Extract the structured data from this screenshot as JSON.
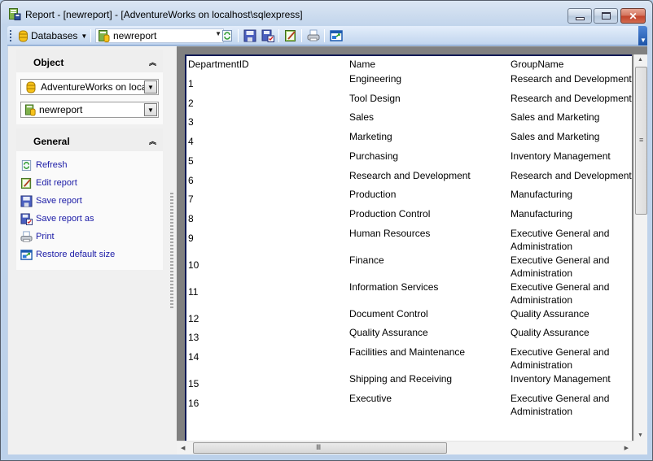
{
  "window": {
    "title": "Report - [newreport] - [AdventureWorks on localhost\\sqlexpress]",
    "controls": {
      "minimize": "minimize",
      "maximize": "maximize",
      "close": "close"
    }
  },
  "toolbar": {
    "databases_label": "Databases",
    "report_combo_value": "newreport",
    "buttons": [
      "Refresh",
      "Save report",
      "Save report as",
      "Edit report",
      "Print",
      "Restore default size"
    ]
  },
  "sidebar": {
    "object_panel": {
      "title": "Object",
      "database_value": "AdventureWorks on localhost\\sqlexpress",
      "report_value": "newreport"
    },
    "general_panel": {
      "title": "General",
      "actions": [
        {
          "label": "Refresh",
          "icon": "refresh-icon"
        },
        {
          "label": "Edit report",
          "icon": "edit-report-icon"
        },
        {
          "label": "Save report",
          "icon": "save-icon"
        },
        {
          "label": "Save report as",
          "icon": "save-as-icon"
        },
        {
          "label": "Print",
          "icon": "print-icon"
        },
        {
          "label": "Restore default size",
          "icon": "restore-size-icon"
        }
      ]
    }
  },
  "report": {
    "columns": [
      "DepartmentID",
      "Name",
      "GroupName"
    ],
    "rows": [
      {
        "id": "1",
        "name": "Engineering",
        "group": [
          "Research and Development"
        ]
      },
      {
        "id": "2",
        "name": "Tool Design",
        "group": [
          "Research and Development"
        ]
      },
      {
        "id": "3",
        "name": "Sales",
        "group": [
          "Sales and Marketing"
        ]
      },
      {
        "id": "4",
        "name": "Marketing",
        "group": [
          "Sales and Marketing"
        ]
      },
      {
        "id": "5",
        "name": "Purchasing",
        "group": [
          "Inventory Management"
        ]
      },
      {
        "id": "6",
        "name": "Research and Development",
        "group": [
          "Research and Development"
        ]
      },
      {
        "id": "7",
        "name": "Production",
        "group": [
          "Manufacturing"
        ]
      },
      {
        "id": "8",
        "name": "Production Control",
        "group": [
          "Manufacturing"
        ]
      },
      {
        "id": "9",
        "name": "Human Resources",
        "group": [
          "Executive General and",
          "Administration"
        ]
      },
      {
        "id": "10",
        "name": "Finance",
        "group": [
          "Executive General and",
          "Administration"
        ]
      },
      {
        "id": "11",
        "name": "Information Services",
        "group": [
          "Executive General and",
          "Administration"
        ]
      },
      {
        "id": "12",
        "name": "Document Control",
        "group": [
          "Quality Assurance"
        ]
      },
      {
        "id": "13",
        "name": "Quality Assurance",
        "group": [
          "Quality Assurance"
        ]
      },
      {
        "id": "14",
        "name": "Facilities and Maintenance",
        "group": [
          "Executive General and",
          "Administration"
        ]
      },
      {
        "id": "15",
        "name": "Shipping and Receiving",
        "group": [
          "Inventory Management"
        ]
      },
      {
        "id": "16",
        "name": "Executive",
        "group": [
          "Executive General and",
          "Administration"
        ]
      }
    ]
  },
  "scrollbars": {
    "vertical_position": 0.0,
    "horizontal_position": 0.0
  }
}
